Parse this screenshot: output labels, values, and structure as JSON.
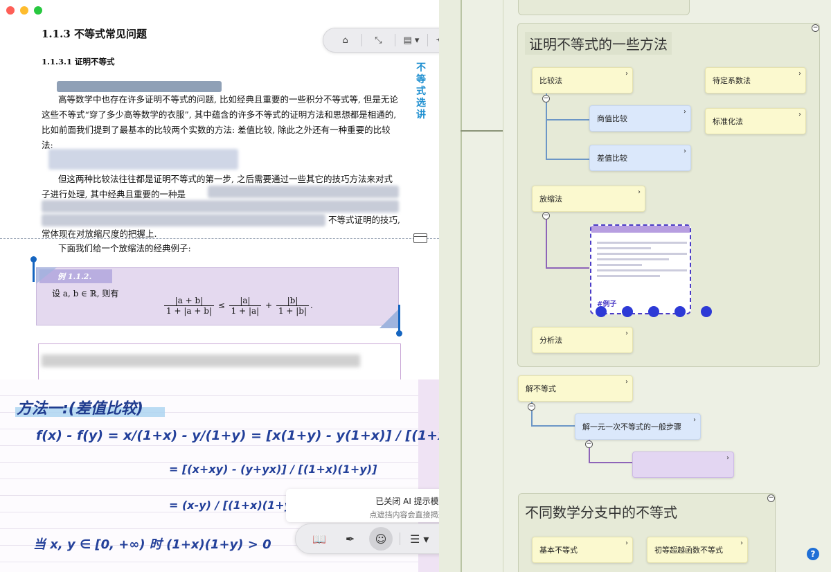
{
  "doc": {
    "section_title": "1.1.3   不等式常见问题",
    "sub_title": "1.1.3.1   证明不等式",
    "vertical_title": "不等式选讲",
    "para1": "高等数学中也存在许多证明不等式的问题, 比如经典且重要的一些积分不等式等, 但是无论这些不等式“穿了多少高等数学的衣服”, 其中蕴含的许多不等式的证明方法和思想都是相通的, 比如前面我们提到了最基本的比较两个实数的方法: 差值比较, 除此之外还有一种重要的比较法:",
    "para2_head": "但这两种比较法往往都是证明不等式的第一步, 之后需要通过一些其它的技巧方法来对式子进行处理, 其中经典且重要的一种是",
    "para2_tail": "不等式证明的技巧,",
    "para2_last": "常体现在对放缩尺度的把握上.",
    "para3": "下面我们给一个放缩法的经典例子:",
    "example_tag": "例 1.1.2.",
    "example_text": "设 a, b ∈ ℝ, 则有",
    "formula": {
      "lhs_num": "|a + b|",
      "lhs_den": "1 + |a + b|",
      "op": "≤",
      "r1_num": "|a|",
      "r1_den": "1 + |a|",
      "plus": "+",
      "r2_num": "|b|",
      "r2_den": "1 + |b|",
      "end": "."
    }
  },
  "top_toolbar": {
    "home": "⌂",
    "collapse": "⤡",
    "page": "▤ ▾",
    "share": "⋲ ▾",
    "search": "⌕"
  },
  "note": {
    "title": "方法一:(差值比较)",
    "line1": "f(x) - f(y) = x/(1+x) - y/(1+y) = [x(1+y) - y(1+x)] / [(1+x)(1+y)]",
    "line2": "= [(x+xy) - (y+yx)] / [(1+x)(1+y)]",
    "line3": "= (x-y) / [(1+x)(1+y)]",
    "line4": "当 x, y ∈ [0, +∞) 时  (1+x)(1+y) > 0"
  },
  "toast": {
    "title": "已关闭 AI 提示模式",
    "subtitle": "点遮挡内容会直接揭开。"
  },
  "bottom_toolbar": {
    "book": "📖",
    "pen": "✒",
    "brain": "☺",
    "list": "☰ ▾",
    "sync": "⟳",
    "bulb": "💡",
    "sliders": "⚙"
  },
  "map": {
    "group1_title": "证明不等式的一些方法",
    "group2_title": "不同数学分支中的不等式",
    "nodes": {
      "bijiao": "比较法",
      "shangzhi": "商值比较",
      "chazhi": "差值比较",
      "fangsuo": "放缩法",
      "fenxi": "分析法",
      "daiding": "待定系数法",
      "biaozhun": "标准化法",
      "jie": "解不等式",
      "jieyiyuan": "解一元一次不等式的一般步骤",
      "jiben": "基本不等式",
      "chudeng": "初等超越函数不等式"
    },
    "image_node_tag": "#例子",
    "help": "?"
  }
}
